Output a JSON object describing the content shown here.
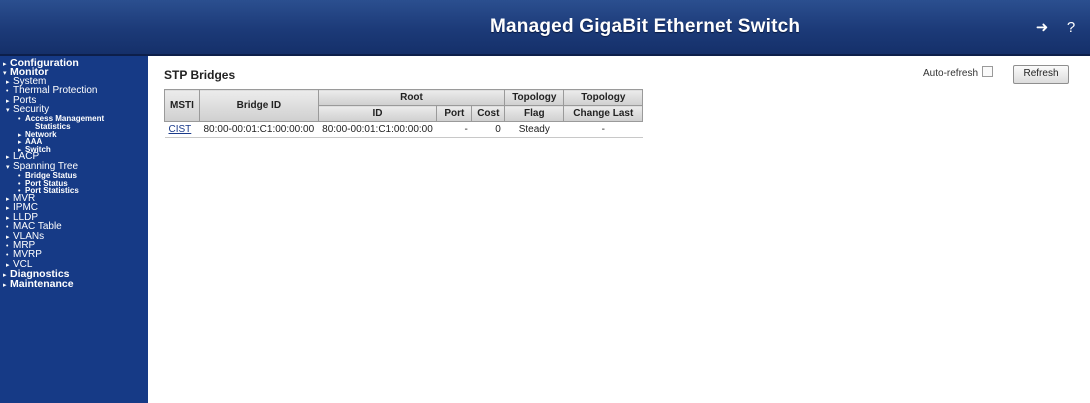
{
  "header": {
    "title": "Managed GigaBit Ethernet Switch",
    "icons": [
      "logout-icon",
      "help-icon"
    ]
  },
  "sidebar": {
    "items": [
      {
        "label": "Configuration",
        "level": 0,
        "marker": "▸"
      },
      {
        "label": "Monitor",
        "level": 0,
        "marker": "▾"
      },
      {
        "label": "System",
        "level": 1,
        "marker": "▸"
      },
      {
        "label": "Thermal Protection",
        "level": 1,
        "marker": "•"
      },
      {
        "label": "Ports",
        "level": 1,
        "marker": "▸"
      },
      {
        "label": "Security",
        "level": 1,
        "marker": "▾"
      },
      {
        "label": "Access Management",
        "level": 2,
        "marker": "•"
      },
      {
        "label": "Statistics",
        "level": 2,
        "marker": ""
      },
      {
        "label": "Network",
        "level": 2,
        "marker": "▸"
      },
      {
        "label": "AAA",
        "level": 2,
        "marker": "▸"
      },
      {
        "label": "Switch",
        "level": 2,
        "marker": "▸"
      },
      {
        "label": "LACP",
        "level": 1,
        "marker": "▸"
      },
      {
        "label": "Spanning Tree",
        "level": 1,
        "marker": "▾"
      },
      {
        "label": "Bridge Status",
        "level": 2,
        "marker": "•"
      },
      {
        "label": "Port Status",
        "level": 2,
        "marker": "•"
      },
      {
        "label": "Port Statistics",
        "level": 2,
        "marker": "•"
      },
      {
        "label": "MVR",
        "level": 1,
        "marker": "▸"
      },
      {
        "label": "IPMC",
        "level": 1,
        "marker": "▸"
      },
      {
        "label": "LLDP",
        "level": 1,
        "marker": "▸"
      },
      {
        "label": "MAC Table",
        "level": 1,
        "marker": "•"
      },
      {
        "label": "VLANs",
        "level": 1,
        "marker": "▸"
      },
      {
        "label": "MRP",
        "level": 1,
        "marker": "•"
      },
      {
        "label": "MVRP",
        "level": 1,
        "marker": "•"
      },
      {
        "label": "VCL",
        "level": 1,
        "marker": "▸"
      },
      {
        "label": "Diagnostics",
        "level": 0,
        "marker": "▸"
      },
      {
        "label": "Maintenance",
        "level": 0,
        "marker": "▸"
      }
    ]
  },
  "main": {
    "title": "STP Bridges",
    "auto_refresh_label": "Auto-refresh",
    "auto_refresh_checked": false,
    "refresh_label": "Refresh",
    "table": {
      "headers": {
        "msti": "MSTI",
        "bridge_id": "Bridge ID",
        "root": "Root",
        "root_id": "ID",
        "root_port": "Port",
        "root_cost": "Cost",
        "topology_flag_1": "Topology",
        "topology_flag_2": "Flag",
        "topology_change_1": "Topology",
        "topology_change_2": "Change Last"
      },
      "rows": [
        {
          "msti": "CIST",
          "bridge_id": "80:00-00:01:C1:00:00:00",
          "root_id": "80:00-00:01:C1:00:00:00",
          "root_port": "-",
          "root_cost": "0",
          "topology_flag": "Steady",
          "topology_change_last": "-"
        }
      ]
    }
  }
}
